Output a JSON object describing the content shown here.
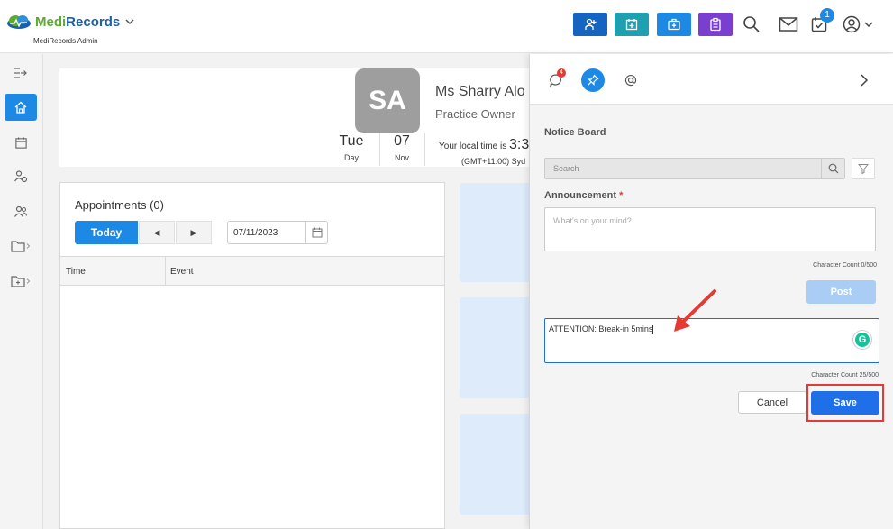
{
  "app": {
    "brand_part1": "Medi",
    "brand_part2": "Records",
    "subtitle": "MediRecords Admin"
  },
  "colors": {
    "brand_green": "#5cab2f",
    "brand_blue": "#1d5fa8",
    "primary": "#1e88e5",
    "save": "#1e6fe8",
    "highlight_red": "#e53935",
    "btn_navy": "#1565c0",
    "btn_teal": "#1fa0b0",
    "btn_blue": "#1e88e5",
    "btn_purple": "#7b3fcf"
  },
  "topbar": {
    "badge_tasks": "1",
    "icons": [
      "add-patient-icon",
      "appointment-icon",
      "medical-kit-icon",
      "clipboard-icon",
      "search-icon",
      "mail-icon",
      "tasks-icon",
      "user-icon"
    ]
  },
  "profile": {
    "initials": "SA",
    "name": "Ms Sharry Alo",
    "role": "Practice Owner",
    "day": "Tue",
    "day_label": "Day",
    "date": "07",
    "month": "Nov",
    "local_time_label": "Your local time is",
    "local_time": "3:3",
    "timezone": "(GMT+11:00) Syd"
  },
  "appointments": {
    "title": "Appointments (0)",
    "today_label": "Today",
    "prev_label": "◀",
    "next_label": "▶",
    "date_value": "07/11/2023",
    "columns": [
      "Time",
      "Event"
    ]
  },
  "panel": {
    "chat_badge": "4",
    "notice_board_title": "Notice Board",
    "search_placeholder": "Search",
    "announcement_label": "Announcement",
    "required_mark": "*",
    "announcement_placeholder": "What's on your mind?",
    "char_count_1": "Character Count 0/500",
    "post_label": "Post",
    "note_value": "ATTENTION: Break-in 5mins",
    "char_count_2": "Character Count 25/500",
    "cancel_label": "Cancel",
    "save_label": "Save"
  }
}
